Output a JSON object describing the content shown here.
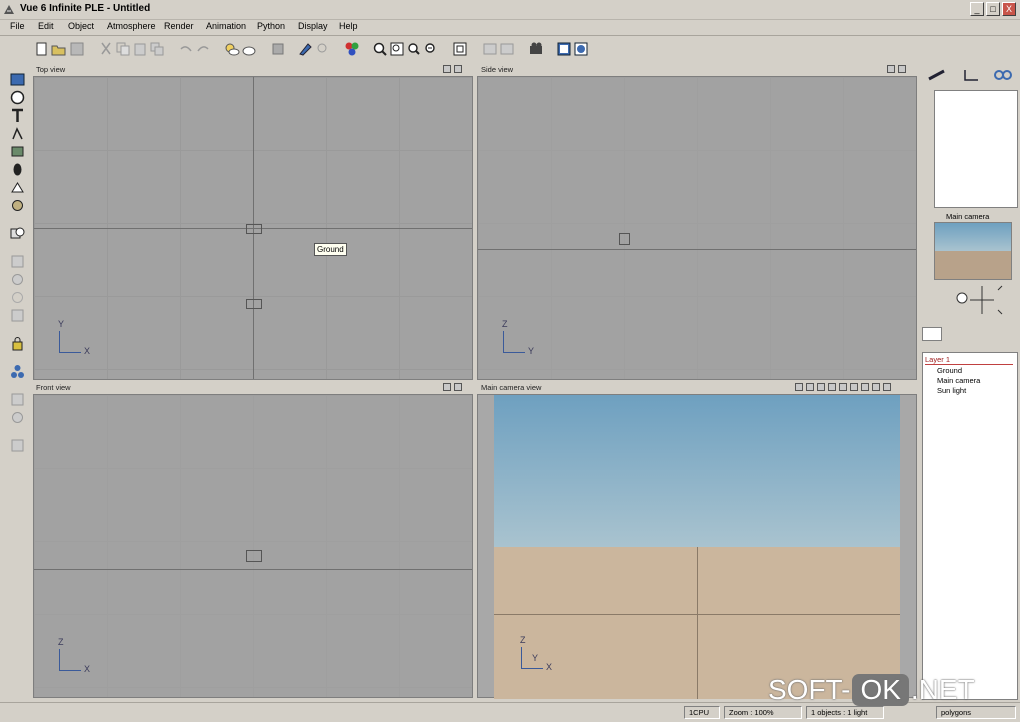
{
  "window": {
    "title": "Vue 6 Infinite PLE - Untitled",
    "buttons": [
      "_",
      "□",
      "X"
    ]
  },
  "menu": [
    "File",
    "Edit",
    "Object",
    "Atmosphere",
    "Render",
    "Animation",
    "Python",
    "Display",
    "Help"
  ],
  "toolbar_icons": [
    "new-icon",
    "open-icon",
    "save-icon",
    "cut-icon",
    "copy-icon",
    "paste-icon",
    "duplicate-icon",
    "undo-icon",
    "redo-icon",
    "atmosphere-icon",
    "clouds-icon",
    "material-icon",
    "edit-object-icon",
    "zoom-icon",
    "color-icon",
    "zoom-region-icon",
    "zoom-fit-icon",
    "zoom-in-icon",
    "zoom-out-icon",
    "frame-icon",
    "render-area-icon",
    "render-icon",
    "camera-icon",
    "display-icon",
    "render-options-icon"
  ],
  "viewports": {
    "top": {
      "title": "Top view",
      "axis_y": "Y",
      "axis_x": "X",
      "label": "Ground"
    },
    "side": {
      "title": "Side view",
      "axis_y": "Z",
      "axis_x": "Y"
    },
    "front": {
      "title": "Front view",
      "axis_y": "Z",
      "axis_x": "X"
    },
    "camera": {
      "title": "Main camera view",
      "axis_z": "Z",
      "axis_y": "Y",
      "axis_x": "X",
      "sky_top": "#6ea0c0",
      "sky_bottom": "#a9c3cf",
      "ground": "#cbb69d"
    }
  },
  "right_panel": {
    "camera_title": "Main camera",
    "layer_tree": [
      "Layer 1",
      "Ground",
      "Main camera",
      "Sun light"
    ]
  },
  "status": {
    "cpu": "1CPU",
    "zoom": "Zoom : 100%",
    "objects": "1 objects : 1 light",
    "polygons": "polygons"
  },
  "watermark": {
    "left": "SOFT-",
    "ok": "OK",
    "right": ".NET"
  }
}
